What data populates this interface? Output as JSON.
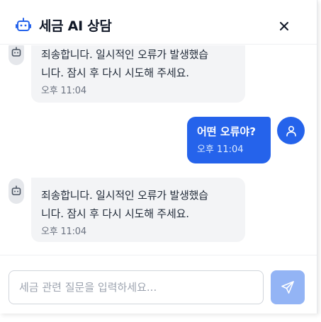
{
  "header": {
    "title": "세금 AI 상담",
    "bot_icon": "robot-icon",
    "close_icon": "close-icon"
  },
  "messages": [
    {
      "role": "bot",
      "lines": [
        "죄송합니다. 일시적인 오류가 발생했습",
        "니다. 잠시 후 다시 시도해 주세요."
      ],
      "time": "오후 11:04"
    },
    {
      "role": "user",
      "text": "어떤 오류야?",
      "time": "오후 11:04"
    },
    {
      "role": "bot",
      "lines": [
        "죄송합니다. 일시적인 오류가 발생했습",
        "니다. 잠시 후 다시 시도해 주세요."
      ],
      "time": "오후 11:04"
    }
  ],
  "input": {
    "value": "",
    "placeholder": "세금 관련 질문을 입력하세요..."
  },
  "send_icon": "send-icon",
  "colors": {
    "accent": "#2563eb",
    "bot_bubble": "#f3f4f6",
    "send_disabled": "#93b4f5"
  }
}
